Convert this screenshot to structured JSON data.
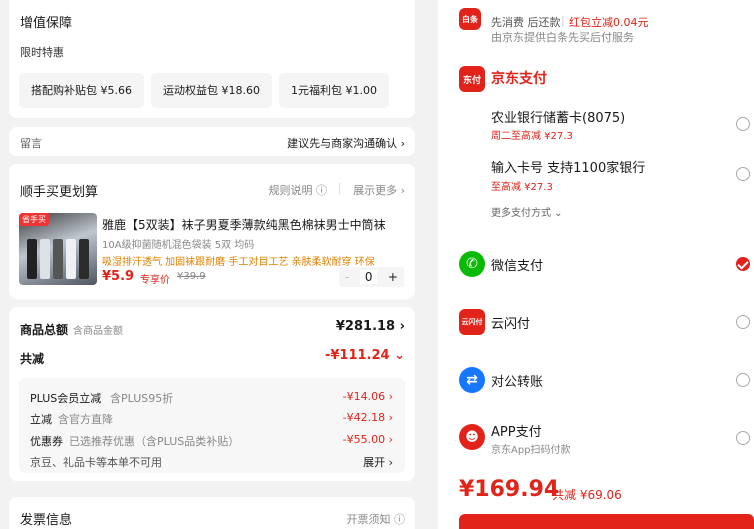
{
  "addon": {
    "title": "增值保障",
    "subtitle": "限时特惠",
    "chips": [
      {
        "label": "搭配购补贴包 ¥5.66"
      },
      {
        "label": "运动权益包 ¥18.60"
      },
      {
        "label": "1元福利包 ¥1.00"
      }
    ]
  },
  "remark": {
    "label": "留言",
    "hint": "建议先与商家沟通确认 ›"
  },
  "addbuy": {
    "title": "顺手买更划算",
    "rule": "规则说明 ⓘ",
    "more": "展示更多 ›",
    "product": {
      "tag": "省手买",
      "name": "雅鹿【5双装】袜子男夏季薄款纯黑色棉袜男士中筒袜",
      "spec": "10A级抑菌随机混色袋装 5双 均码",
      "features": "吸湿排汗透气 加固袜跟耐磨 手工对目工艺 亲肤柔软耐穿 环保",
      "price": "¥5.9",
      "plus_label": "专享价",
      "orig_price": "¥39.9",
      "qty_minus": "-",
      "qty": "0",
      "qty_plus": "+"
    }
  },
  "totals": {
    "goods_label": "商品总额",
    "goods_sub": "含商品金额",
    "goods_value": "¥281.18 ›",
    "discount_label": "共减",
    "discount_value": "-¥111.24 ⌄",
    "rows": [
      {
        "k": "PLUS会员立减",
        "d": "含PLUS95折",
        "v": "-¥14.06 ›"
      },
      {
        "k": "立减",
        "d": "含官方直降",
        "v": "-¥42.18 ›"
      },
      {
        "k": "优惠券",
        "d": "已选推荐优惠（含PLUS品类补贴）",
        "v": "-¥55.00 ›"
      }
    ],
    "giftcard_text": "京豆、礼品卡等本单不可用",
    "giftcard_action": "展开 ›"
  },
  "invoice": {
    "title": "发票信息",
    "hint": "开票须知 ⓘ"
  },
  "pay": {
    "baitiao": {
      "icon": "白条",
      "line1": "先消费 后还款",
      "line1_red": "红包立减0.04元",
      "line2": "由京东提供白条先买后付服务"
    },
    "jdpay": {
      "icon": "东付",
      "title": "京东支付"
    },
    "methods": [
      {
        "name": "农业银行储蓄卡(8075)",
        "sub": "周二至高减 ¥27.3"
      },
      {
        "name": "输入卡号 支持1100家银行",
        "sub": "至高减 ¥27.3"
      }
    ],
    "more": "更多支付方式 ⌄",
    "wechat": "微信支付",
    "unionpay": {
      "icon": "云闪付",
      "name": "云闪付"
    },
    "corporate": "对公转账",
    "app": {
      "name": "APP支付",
      "sub": "京东App扫码付款"
    },
    "total": "¥169.94",
    "saved": "共减 ¥69.06",
    "colors": {
      "accent": "#e2231a",
      "wechat": "#09bb07",
      "transfer": "#1677ff"
    }
  }
}
